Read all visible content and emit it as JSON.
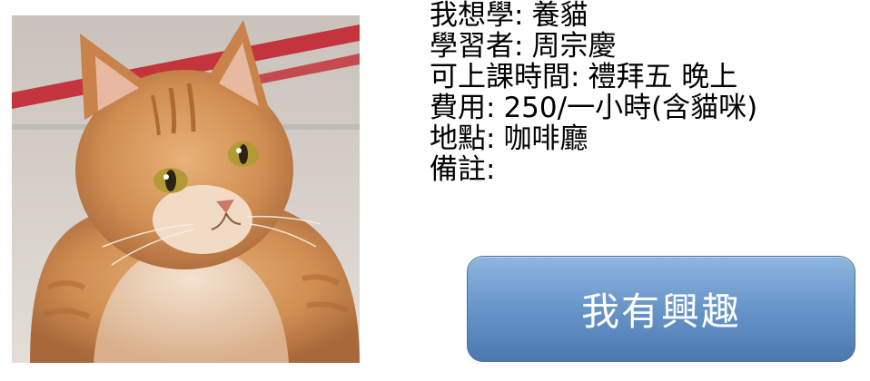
{
  "photo": {
    "icon": "orange-tabby-cat-photo"
  },
  "info": {
    "rows": [
      {
        "key": "我想學",
        "value": "養貓"
      },
      {
        "key": "學習者",
        "value": "周宗慶"
      },
      {
        "key": "可上課時間",
        "value": "禮拜五 晚上"
      },
      {
        "key": "費用",
        "value": "250/一小時(含貓咪)"
      },
      {
        "key": "地點",
        "value": "咖啡廳"
      },
      {
        "key": "備註",
        "value": ""
      }
    ]
  },
  "button": {
    "label": "我有興趣",
    "color_top": "#8fb6df",
    "color_bottom": "#4b79b0"
  }
}
